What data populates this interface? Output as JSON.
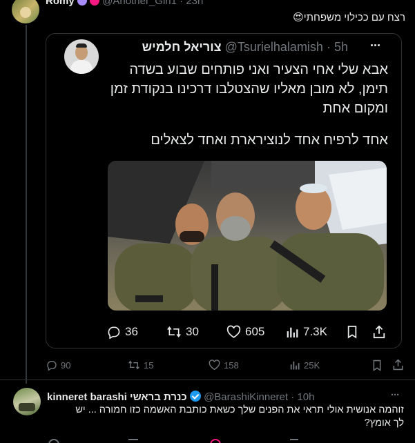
{
  "top_tweet": {
    "author_name": "Romy",
    "author_handle": "@Another_Girl1",
    "time": "· 23h",
    "text": "רצח עם ככילוי משפחתי😍",
    "stats": {
      "replies": "90",
      "retweets": "15",
      "likes": "158",
      "views": "25K"
    }
  },
  "quoted_tweet": {
    "author_name": "צוריאל חלמיש",
    "author_handle": "@Tsurielhalamish",
    "time": "· 5h",
    "text_lines": [
      "אבא שלי אחי הצעיר ואני פותחים שבוע בשדה",
      "תימן, לא מובן מאליו שהצטלבו דרכינו בנקודת זמן",
      "ומקום אחת"
    ],
    "text_line2": "אחד לרפיח אחד לנוצירארת ואחד לצאלים",
    "stats": {
      "replies": "36",
      "retweets": "30",
      "likes": "605",
      "views": "7.3K"
    }
  },
  "reply_tweet": {
    "author_name": "kinneret barashi כנרת בראשי",
    "author_handle": "@BarashiKinneret",
    "time": "· 10h",
    "text_lines": [
      "זוהמה אנושית אולי תראי את הפנים שלך כשאת כותבת האשמה כזו חמורה ... יש",
      "לך אומץ?"
    ]
  },
  "menu_glyph": "···",
  "colors": {
    "background": "#000000",
    "text": "#e7e9ea",
    "muted": "#71767b",
    "border": "#2f3336",
    "verified": "#1d9bf0"
  }
}
